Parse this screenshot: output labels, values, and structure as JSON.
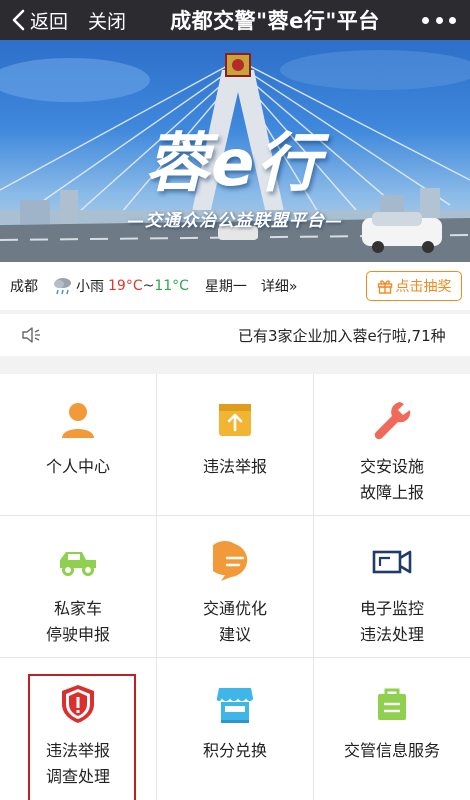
{
  "topbar": {
    "back_label": "返回",
    "close_label": "关闭",
    "title": "成都交警\"蓉e行\"平台"
  },
  "banner": {
    "logo_text": "蓉e行",
    "slogan": "—交通众治公益联盟平台—"
  },
  "weather": {
    "city": "成都",
    "condition": "小雨",
    "high": "19°C",
    "tilde": "~",
    "low": "11°C",
    "weekday": "星期一",
    "detail": "详细»",
    "lottery_label": "点击抽奖"
  },
  "notice": {
    "text": "已有3家企业加入蓉e行啦,71种"
  },
  "services": [
    {
      "line1": "个人中心",
      "line2": "",
      "icon": "person-icon",
      "color": "#f29a3a"
    },
    {
      "line1": "违法举报",
      "line2": "",
      "icon": "upload-report-icon",
      "color": "#f2b533"
    },
    {
      "line1": "交安设施",
      "line2": "故障上报",
      "icon": "wrench-icon",
      "color": "#ef6a5a"
    },
    {
      "line1": "私家车",
      "line2": "停驶申报",
      "icon": "car-icon",
      "color": "#8fd14f"
    },
    {
      "line1": "交通优化",
      "line2": "建议",
      "icon": "chat-bubble-icon",
      "color": "#f29a3a"
    },
    {
      "line1": "电子监控",
      "line2": "违法处理",
      "icon": "camera-icon",
      "color": "#1f3a6b"
    },
    {
      "line1": "违法举报",
      "line2": "调查处理",
      "icon": "shield-alert-icon",
      "color": "#d9302e"
    },
    {
      "line1": "积分兑换",
      "line2": "",
      "icon": "store-icon",
      "color": "#3fb6e8"
    },
    {
      "line1": "交管信息服务",
      "line2": "",
      "icon": "info-bag-icon",
      "color": "#8fd14f"
    }
  ]
}
